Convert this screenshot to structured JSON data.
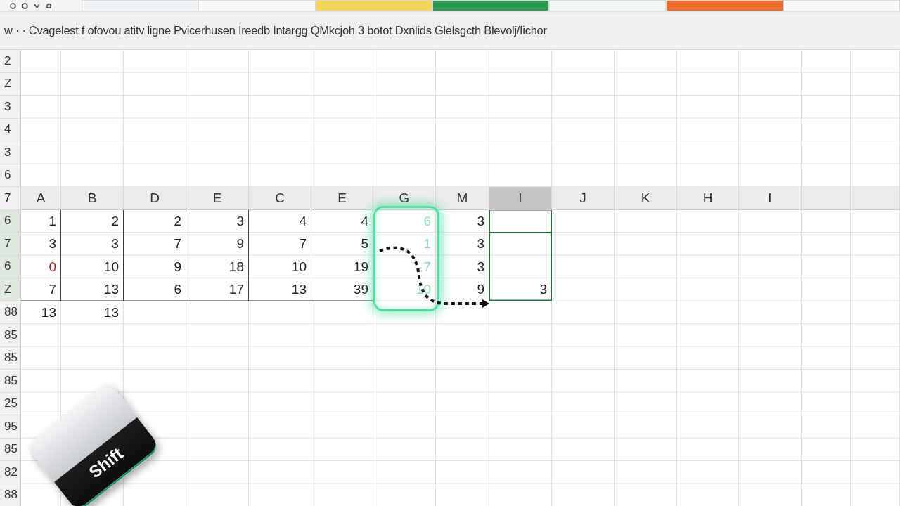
{
  "top_strip": {
    "segments": [
      {
        "color": "#eef3f8"
      },
      {
        "color": "#fafafa"
      },
      {
        "color": "#f7d35a"
      },
      {
        "color": "#2f9a4f"
      },
      {
        "color": "#f1f6f2"
      },
      {
        "color": "#ee6f2d"
      },
      {
        "color": "#fafafa"
      }
    ]
  },
  "message": "w · · Cvagelest f ofovou atitv ligne Pvicerhusen Ireedb Intargg QMkcjoh 3 botot Dxnlids Glelsgcth Blevolj/Iichor",
  "sheet": {
    "columns": [
      {
        "label": "A",
        "selected": false,
        "glow": false
      },
      {
        "label": "B",
        "selected": false,
        "glow": false
      },
      {
        "label": "D",
        "selected": false,
        "glow": false
      },
      {
        "label": "E",
        "selected": false,
        "glow": false
      },
      {
        "label": "C",
        "selected": false,
        "glow": false
      },
      {
        "label": "E",
        "selected": false,
        "glow": false
      },
      {
        "label": "G",
        "selected": false,
        "glow": true
      },
      {
        "label": "M",
        "selected": false,
        "glow": false
      },
      {
        "label": "I",
        "selected": true,
        "glow": false
      },
      {
        "label": "J",
        "selected": false,
        "glow": false
      },
      {
        "label": "K",
        "selected": false,
        "glow": false
      },
      {
        "label": "H",
        "selected": false,
        "glow": false
      },
      {
        "label": "I",
        "selected": false,
        "glow": false
      }
    ],
    "header_row_label": "7",
    "rows_above": [
      {
        "label": "2"
      },
      {
        "label": "Z"
      },
      {
        "label": "3"
      },
      {
        "label": "4"
      },
      {
        "label": "3"
      },
      {
        "label": "6"
      }
    ],
    "rows": [
      {
        "label": "6",
        "selected": true,
        "cells": [
          "1",
          "2",
          "2",
          "3",
          "4",
          "4",
          "6",
          "3"
        ]
      },
      {
        "label": "7",
        "selected": true,
        "cells": [
          "3",
          "3",
          "7",
          "9",
          "7",
          "5",
          "1",
          "3"
        ]
      },
      {
        "label": "6",
        "selected": true,
        "cells": [
          {
            "text": "0",
            "color": "#9b1f1f"
          },
          "10",
          "9",
          "18",
          "10",
          "19",
          "7",
          "3"
        ]
      },
      {
        "label": "Z",
        "selected": true,
        "cells": [
          "7",
          "13",
          "6",
          "17",
          "13",
          "39",
          "10",
          "9",
          "3"
        ]
      },
      {
        "label": "88",
        "selected": false,
        "cells": [
          "13",
          "13"
        ]
      },
      {
        "label": "85",
        "selected": false,
        "cells": []
      },
      {
        "label": "85",
        "selected": false,
        "cells": []
      },
      {
        "label": "85",
        "selected": false,
        "cells": []
      },
      {
        "label": "25",
        "selected": false,
        "cells": []
      },
      {
        "label": "95",
        "selected": false,
        "cells": []
      },
      {
        "label": "85",
        "selected": false,
        "cells": []
      },
      {
        "label": "82",
        "selected": false,
        "cells": []
      },
      {
        "label": "88",
        "selected": false,
        "cells": []
      }
    ]
  },
  "key": {
    "label": "Shift"
  }
}
